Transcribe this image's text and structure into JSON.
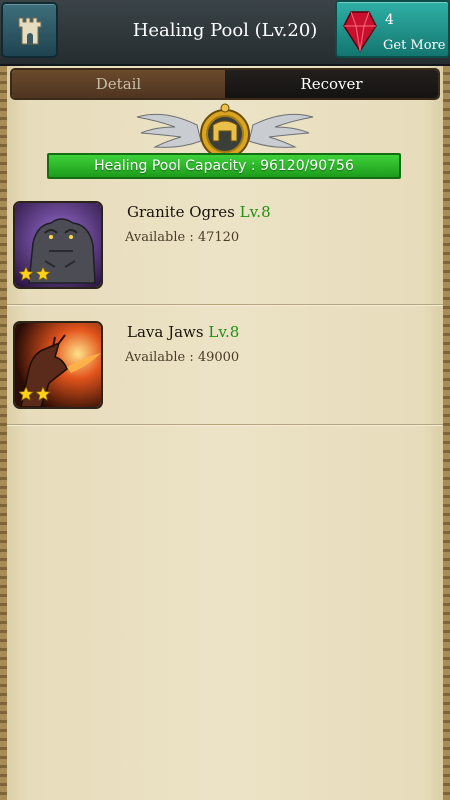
{
  "header": {
    "title": "Healing Pool (Lv.20)",
    "gem_count": "4",
    "get_more_label": "Get More"
  },
  "tabs": [
    {
      "label": "Detail",
      "active": false
    },
    {
      "label": "Recover",
      "active": true
    }
  ],
  "capacity": {
    "label": "Healing Pool Capacity : 96120/90756"
  },
  "units": [
    {
      "name": "Granite Ogres",
      "level": "Lv.8",
      "available": "Available : 47120",
      "stars": 2
    },
    {
      "name": "Lava Jaws",
      "level": "Lv.8",
      "available": "Available : 49000",
      "stars": 2
    }
  ],
  "icons": {
    "home": "castle-tower-icon",
    "gem": "red-gem-icon",
    "emblem": "winged-helmet-emblem-icon"
  },
  "colors": {
    "capacity_bar": "#2dbb2a",
    "level_text": "#1e8f12",
    "gem_button": "#1f9a91",
    "active_tab": "#1a1716",
    "inactive_tab": "#5c3f27"
  }
}
